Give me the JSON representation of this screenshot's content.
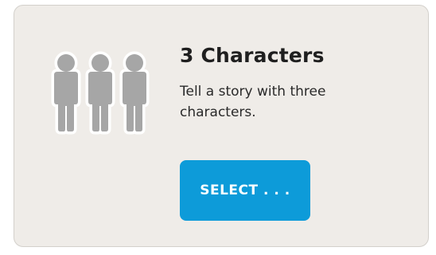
{
  "card": {
    "icon": "three-people-icon",
    "title": "3 Characters",
    "description": "Tell a story with three characters.",
    "select_label": "SELECT . . ."
  },
  "colors": {
    "card_background": "#efece8",
    "button_background": "#0d9bd9",
    "figure_fill": "#a6a6a6",
    "figure_outline": "#ffffff"
  }
}
